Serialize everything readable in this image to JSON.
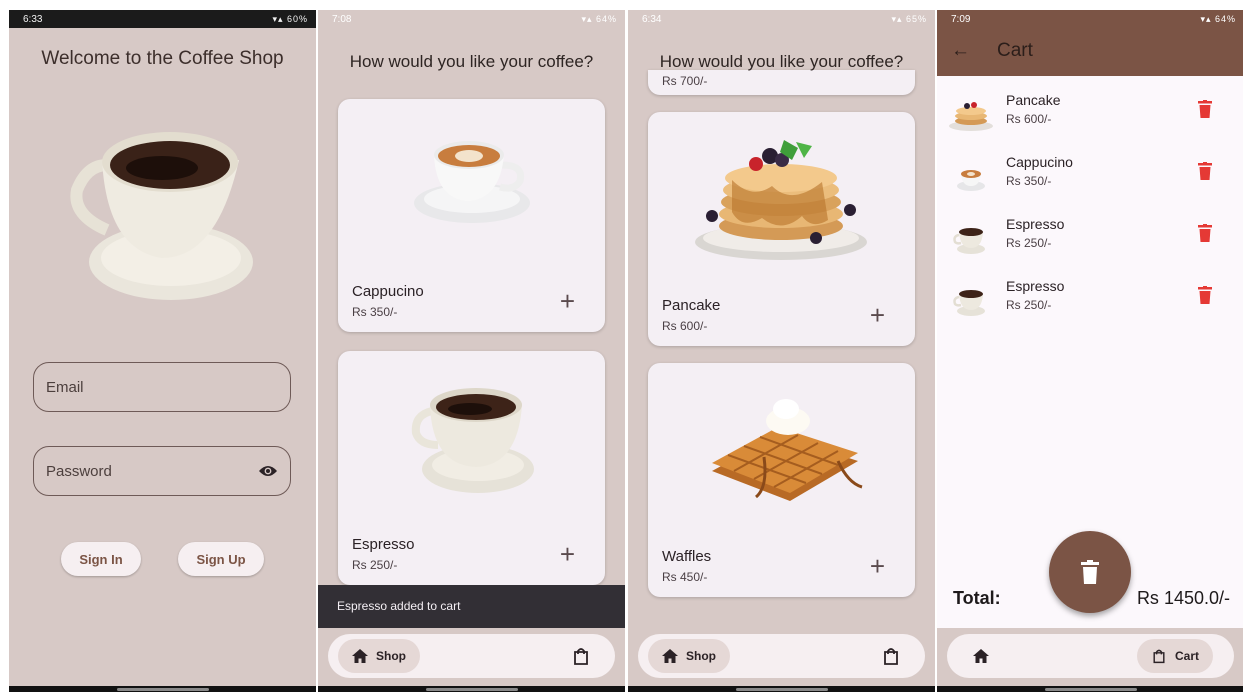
{
  "colors": {
    "brand_brown": "#7b5445",
    "background": "#d7c9c6",
    "card": "#f4eff4",
    "delete_red": "#e53935"
  },
  "panel1": {
    "status": {
      "time": "6:33",
      "battery": "60%"
    },
    "title": "Welcome to the Coffee Shop",
    "email_placeholder": "Email",
    "password_placeholder": "Password",
    "sign_in": "Sign In",
    "sign_up": "Sign Up"
  },
  "panel2": {
    "status": {
      "time": "7:08",
      "battery": "64%"
    },
    "title": "How would you like your coffee?",
    "items": [
      {
        "name": "Cappucino",
        "price": "Rs 350/-"
      },
      {
        "name": "Espresso",
        "price": "Rs 250/-"
      }
    ],
    "snackbar": "Espresso added to cart",
    "nav_shop": "Shop"
  },
  "panel3": {
    "status": {
      "time": "6:34",
      "battery": "65%"
    },
    "title": "How would you like your coffee?",
    "partial_price": "Rs 700/-",
    "items": [
      {
        "name": "Pancake",
        "price": "Rs 600/-"
      },
      {
        "name": "Waffles",
        "price": "Rs 450/-"
      }
    ],
    "nav_shop": "Shop"
  },
  "panel4": {
    "status": {
      "time": "7:09",
      "battery": "64%"
    },
    "title": "Cart",
    "items": [
      {
        "name": "Pancake",
        "price": "Rs 600/-"
      },
      {
        "name": "Cappucino",
        "price": "Rs 350/-"
      },
      {
        "name": "Espresso",
        "price": "Rs 250/-"
      },
      {
        "name": "Espresso",
        "price": "Rs 250/-"
      }
    ],
    "total_label": "Total:",
    "total_value": "Rs 1450.0/-",
    "nav_cart": "Cart"
  }
}
